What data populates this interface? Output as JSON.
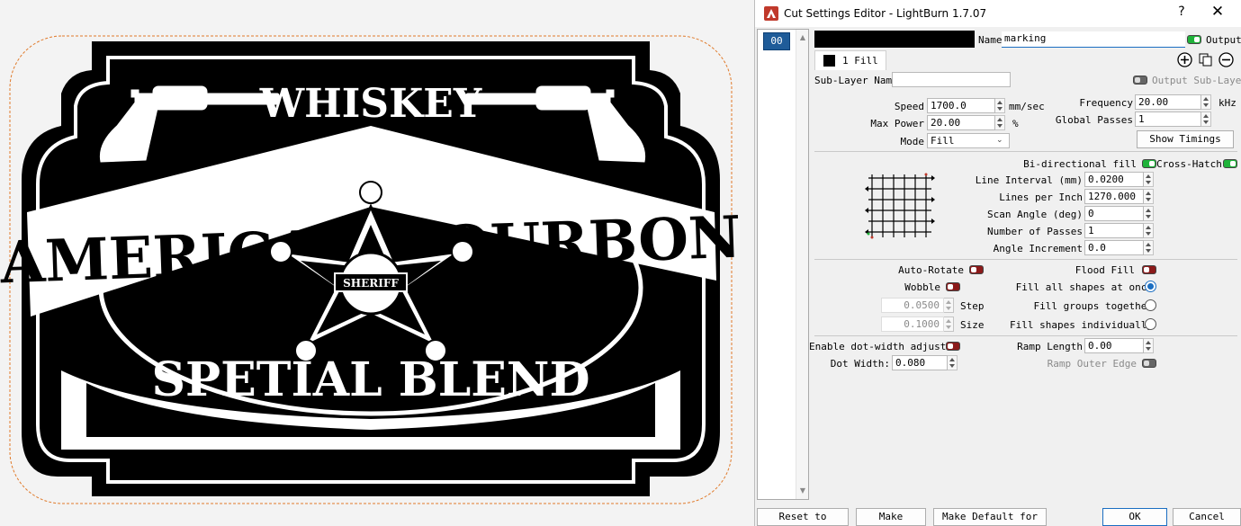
{
  "canvas": {
    "label": {
      "top_text": "WHISKEY",
      "banner_text": "AMERICAN BOURBON",
      "bottom_text": "SPETIAL BLEND",
      "badge_text": "SHERIFF"
    },
    "outline_color": "#e07a2a"
  },
  "dialog": {
    "title": "Cut Settings Editor - LightBurn 1.7.07",
    "help_glyph": "?",
    "close_glyph": "✕",
    "layer_chip": "00",
    "layer_color": "#000000",
    "name_label": "Name",
    "name_value": "marking",
    "output_label": "Output",
    "sublayer_tab": "1 Fill",
    "sublayer_name_label": "Sub-Layer Name",
    "sublayer_name_value": "",
    "output_sublayer_label": "Output Sub-Layer",
    "speed_label": "Speed",
    "speed_value": "1700.0",
    "speed_unit": "mm/sec",
    "max_power_label": "Max Power",
    "max_power_value": "20.00",
    "max_power_unit": "%",
    "mode_label": "Mode",
    "mode_value": "Fill",
    "frequency_label": "Frequency",
    "frequency_value": "20.00",
    "frequency_unit": "kHz",
    "global_passes_label": "Global Passes",
    "global_passes_value": "1",
    "show_timings_label": "Show Timings",
    "bidirectional_label": "Bi-directional fill",
    "crosshatch_label": "Cross-Hatch",
    "line_interval_label": "Line Interval (mm)",
    "line_interval_value": "0.0200",
    "lpi_label": "Lines per Inch",
    "lpi_value": "1270.000",
    "scan_angle_label": "Scan Angle (deg)",
    "scan_angle_value": "0",
    "num_passes_label": "Number of Passes",
    "num_passes_value": "1",
    "angle_increment_label": "Angle Increment",
    "angle_increment_value": "0.0",
    "auto_rotate_label": "Auto-Rotate",
    "flood_fill_label": "Flood Fill",
    "wobble_label": "Wobble",
    "wobble_step_value": "0.0500",
    "wobble_step_label": "Step",
    "wobble_size_value": "0.1000",
    "wobble_size_label": "Size",
    "fill_all_label": "Fill all shapes at once",
    "fill_groups_label": "Fill groups together",
    "fill_individually_label": "Fill shapes individually",
    "dot_width_adjust_label": "Enable dot-width adjust",
    "dot_width_label": "Dot Width:",
    "dot_width_value": "0.080",
    "ramp_length_label": "Ramp Length",
    "ramp_length_value": "0.00",
    "ramp_outer_label": "Ramp Outer Edge",
    "reset_default_label": "Reset to Default",
    "make_default_label": "Make Default",
    "make_default_all_label": "Make Default for All",
    "ok_label": "OK",
    "cancel_label": "Cancel",
    "colors": {
      "accent": "#1b6ec2",
      "toggle_on": "#1fb33a",
      "toggle_off": "#8b1a1a"
    }
  }
}
